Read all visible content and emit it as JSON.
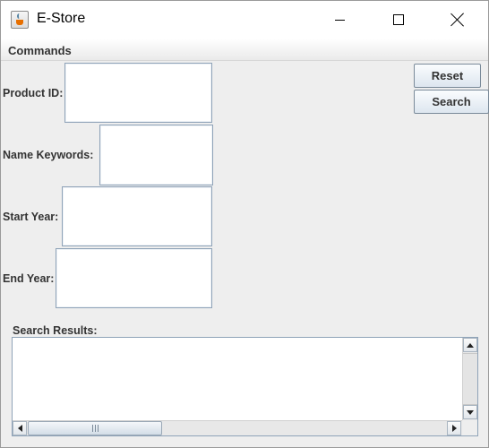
{
  "window": {
    "title": "E-Store",
    "icon": "java-cup-icon"
  },
  "menubar": {
    "items": [
      {
        "label": "Commands"
      }
    ]
  },
  "form": {
    "product_id_label": "Product ID:",
    "product_id_value": "",
    "name_keywords_label": "Name Keywords:",
    "name_keywords_value": "",
    "start_year_label": "Start Year:",
    "start_year_value": "",
    "end_year_label": "End Year:",
    "end_year_value": ""
  },
  "buttons": {
    "reset_label": "Reset",
    "search_label": "Search"
  },
  "results": {
    "label": "Search Results:",
    "value": ""
  }
}
